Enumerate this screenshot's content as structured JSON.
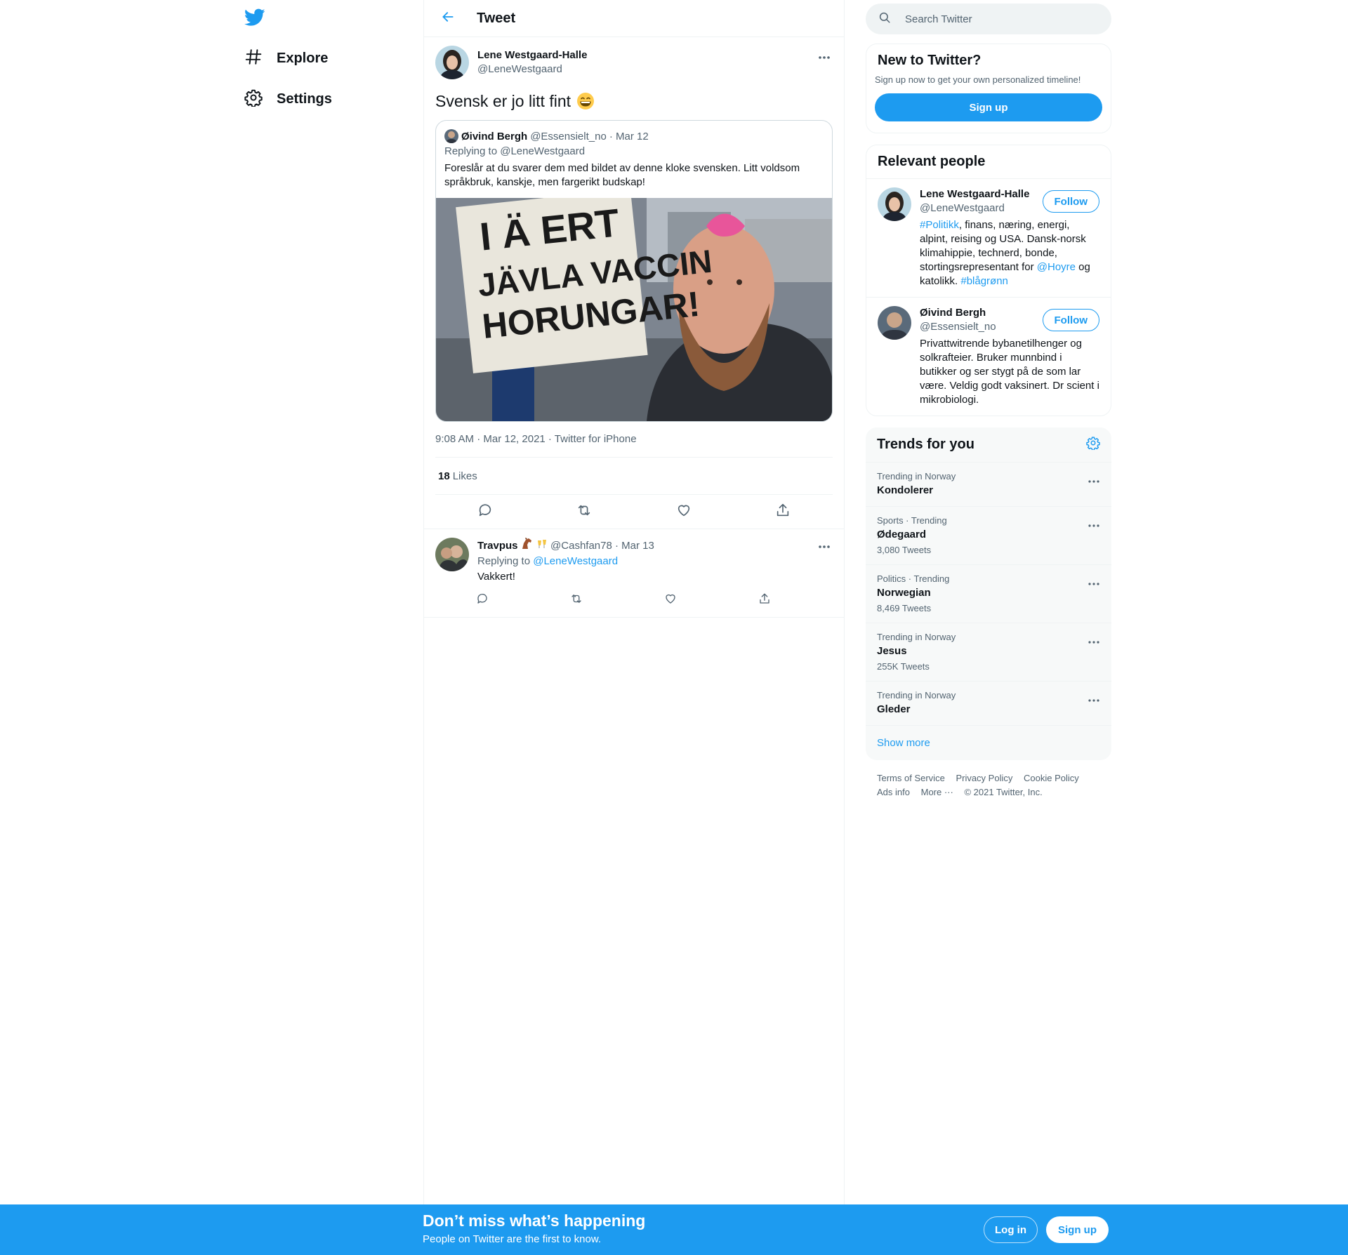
{
  "nav": {
    "items": [
      {
        "label": "Explore",
        "icon": "hashtag-icon"
      },
      {
        "label": "Settings",
        "icon": "gear-icon"
      }
    ]
  },
  "header": {
    "title": "Tweet"
  },
  "main_tweet": {
    "author_name": "Lene Westgaard-Halle",
    "author_handle": "@LeneWestgaard",
    "text": "Svensk er jo litt fint",
    "emoji": "grinning-face-emoji",
    "quote": {
      "author_name": "Øivind Bergh",
      "author_handle": "@Essensielt_no",
      "date": "· Mar 12",
      "replying_to": "Replying to @LeneWestgaard",
      "text": "Foreslår at du svarer dem med bildet av denne kloke svensken. Litt voldsom språkbruk, kanskje, men fargerikt budskap!",
      "image_sign_lines": [
        "I Ä ERT",
        "JÄVLA VACCIN",
        "HORUNGAR!"
      ]
    },
    "timestamp": "9:08 AM · Mar 12, 2021 · Twitter for iPhone",
    "likes_count": "18",
    "likes_label": "Likes"
  },
  "reply": {
    "author_name": "Travpus",
    "author_handle": "@Cashfan78",
    "date": "· Mar 13",
    "replying_prefix": "Replying to",
    "replying_handle": "@LeneWestgaard",
    "text": "Vakkert!"
  },
  "search": {
    "placeholder": "Search Twitter"
  },
  "new_to_twitter": {
    "title": "New to Twitter?",
    "subtitle": "Sign up now to get your own personalized timeline!",
    "button": "Sign up"
  },
  "relevant_people": {
    "title": "Relevant people",
    "follow_label": "Follow",
    "people": [
      {
        "name": "Lene Westgaard-Halle",
        "handle": "@LeneWestgaard",
        "bio_parts": [
          {
            "text": "#Politikk",
            "link": true
          },
          {
            "text": ", finans, næring, energi, alpint, reising og USA. Dansk-norsk klimahippie, technerd, bonde, stortingsrepresentant for ",
            "link": false
          },
          {
            "text": "@Hoyre",
            "link": true
          },
          {
            "text": " og katolikk. ",
            "link": false
          },
          {
            "text": "#blågrønn",
            "link": true
          }
        ]
      },
      {
        "name": "Øivind Bergh",
        "handle": "@Essensielt_no",
        "bio_parts": [
          {
            "text": "Privattwitrende bybanetilhenger og solkrafteier. Bruker munnbind i butikker og ser stygt på de som lar være. Veldig godt vaksinert. Dr scient i mikrobiologi.",
            "link": false
          }
        ]
      }
    ]
  },
  "trends": {
    "title": "Trends for you",
    "items": [
      {
        "context": "Trending in Norway",
        "name": "Kondolerer",
        "count": ""
      },
      {
        "context": "Sports · Trending",
        "name": "Ødegaard",
        "count": "3,080 Tweets"
      },
      {
        "context": "Politics · Trending",
        "name": "Norwegian",
        "count": "8,469 Tweets"
      },
      {
        "context": "Trending in Norway",
        "name": "Jesus",
        "count": "255K Tweets"
      },
      {
        "context": "Trending in Norway",
        "name": "Gleder",
        "count": ""
      }
    ],
    "show_more": "Show more"
  },
  "footer": {
    "links": [
      "Terms of Service",
      "Privacy Policy",
      "Cookie Policy",
      "Ads info",
      "More ···"
    ],
    "copyright": "© 2021 Twitter, Inc."
  },
  "bottom_bar": {
    "title": "Don’t miss what’s happening",
    "subtitle": "People on Twitter are the first to know.",
    "login": "Log in",
    "signup": "Sign up"
  },
  "colors": {
    "accent": "#1d9bf0",
    "text": "#0f1419",
    "muted": "#536471",
    "border": "#eff3f4"
  }
}
